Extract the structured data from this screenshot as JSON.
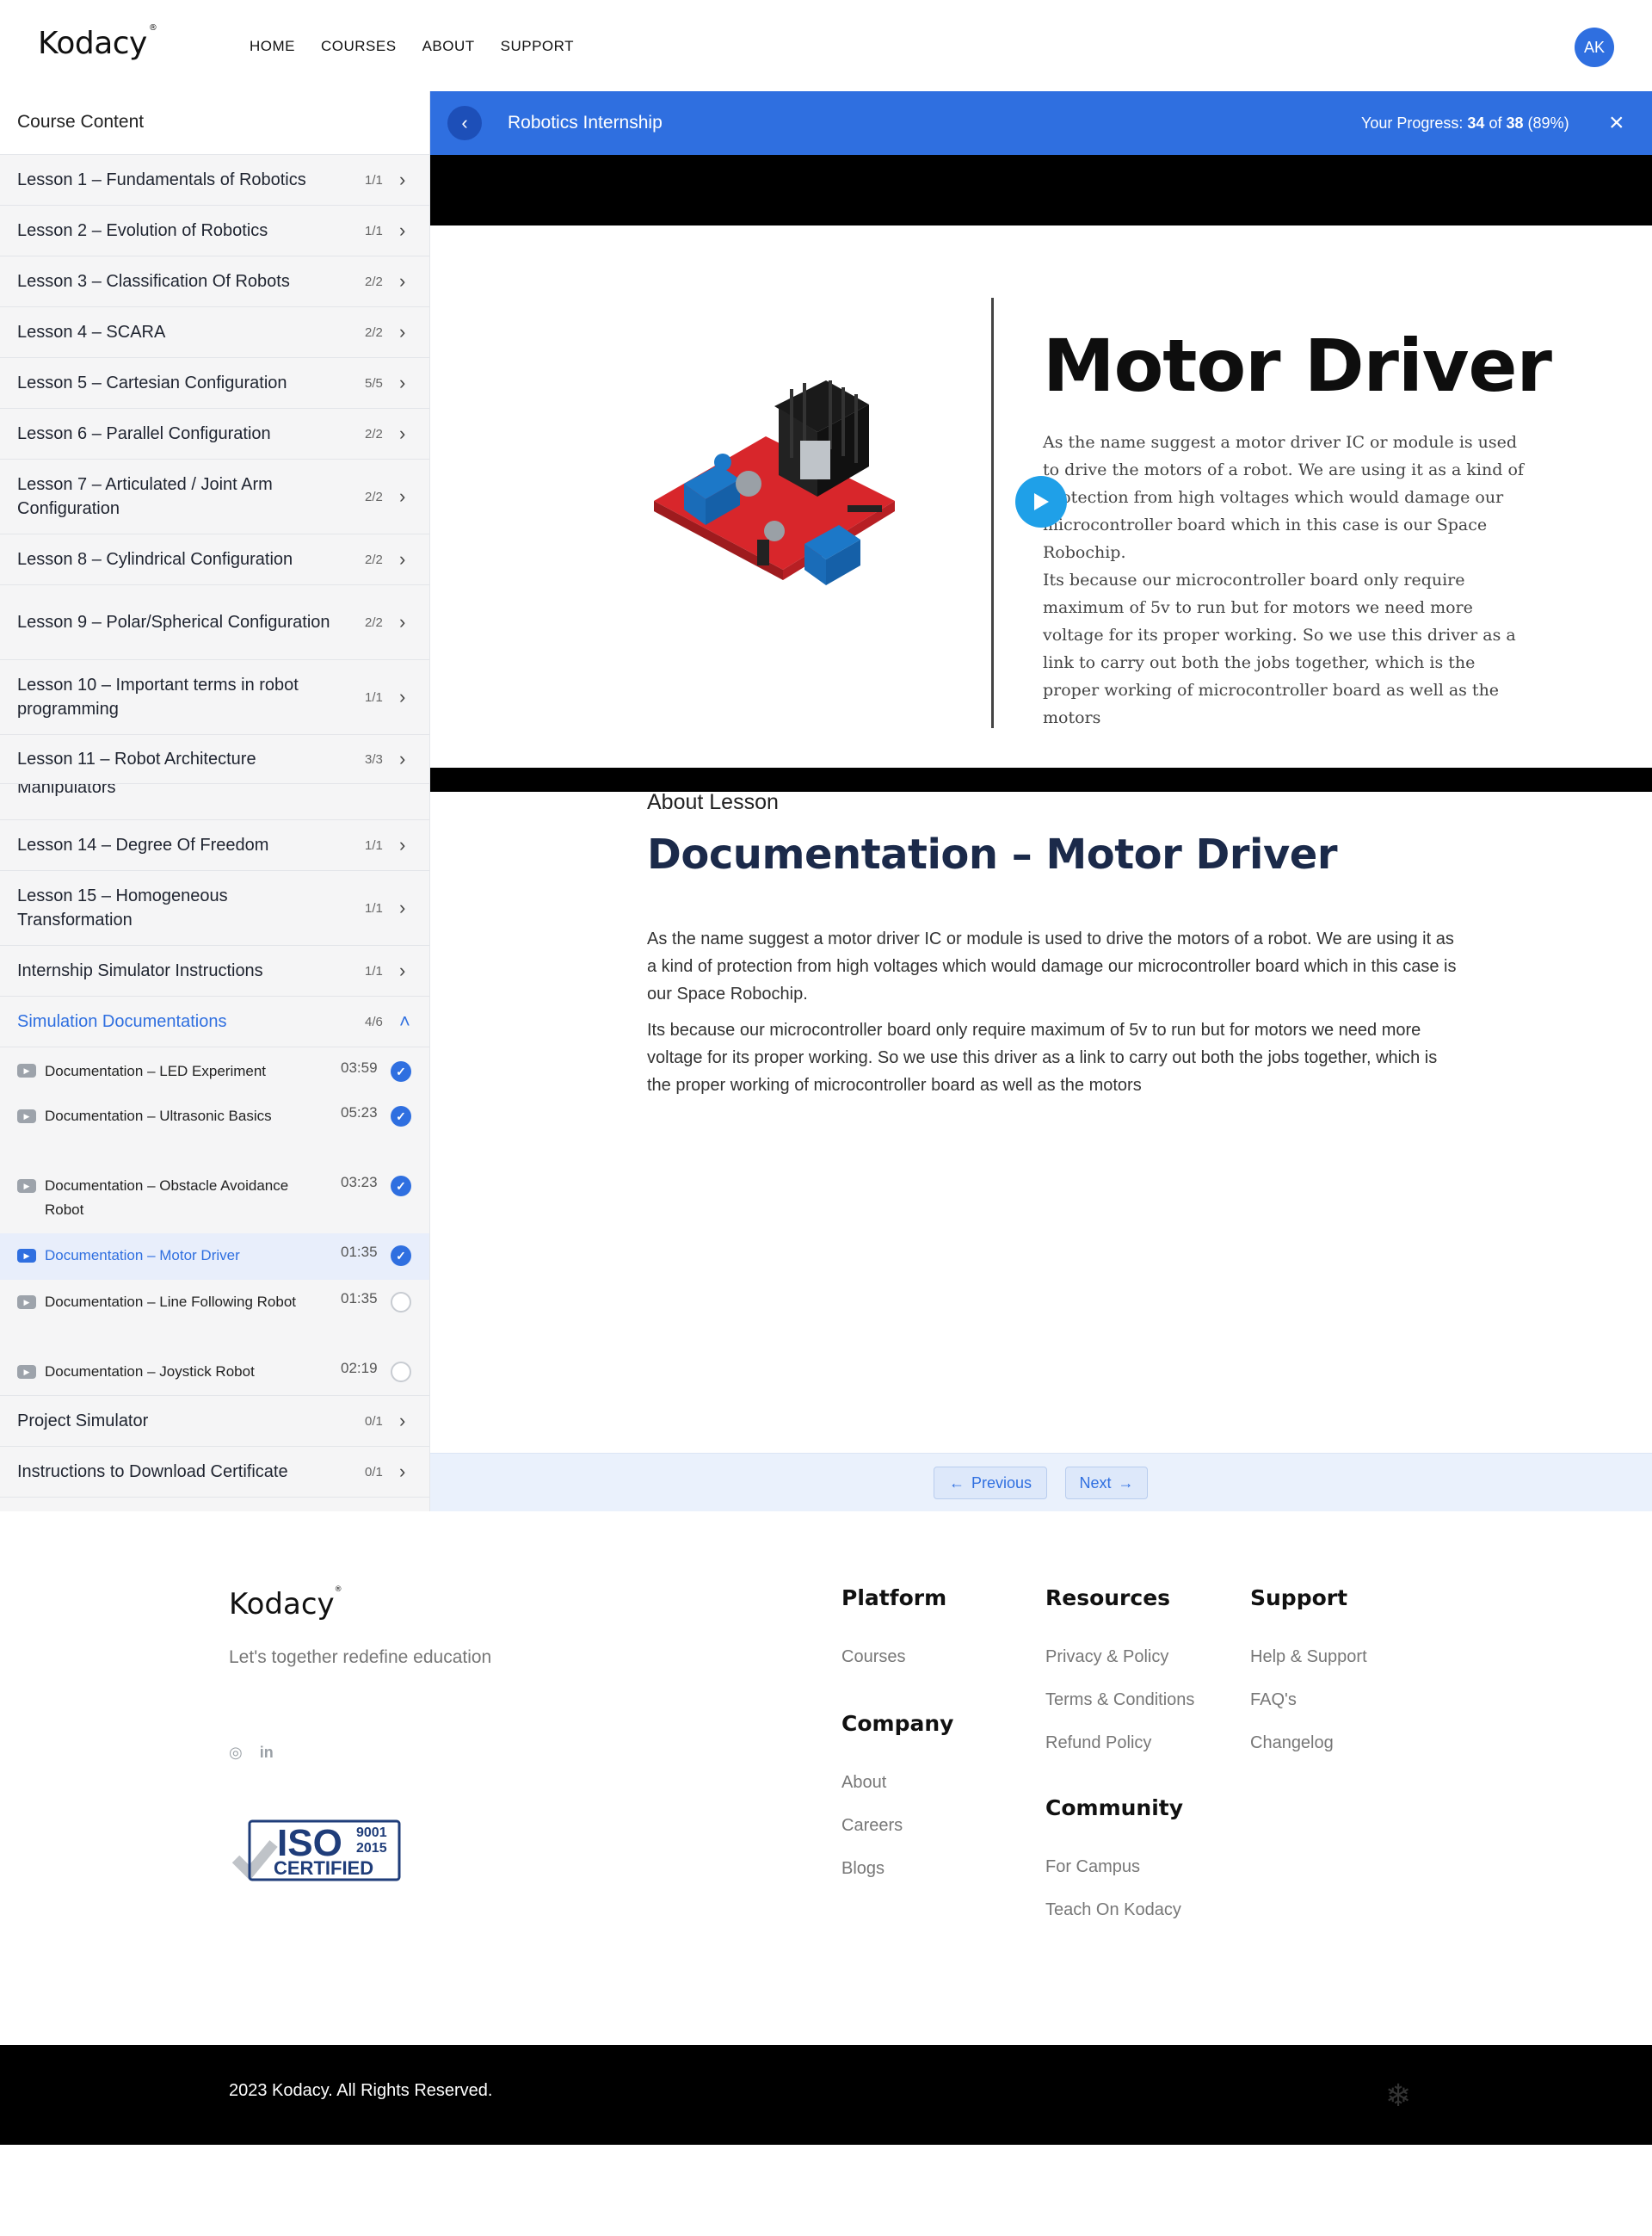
{
  "header": {
    "logo": "Kodacy",
    "nav": [
      "HOME",
      "COURSES",
      "ABOUT",
      "SUPPORT"
    ],
    "avatar": "AK"
  },
  "sidebar": {
    "title": "Course Content",
    "lessons": [
      {
        "label": "Lesson 1 – Fundamentals of Robotics",
        "count": "1/1"
      },
      {
        "label": "Lesson 2 – Evolution of Robotics",
        "count": "1/1"
      },
      {
        "label": "Lesson 3 – Classification Of Robots",
        "count": "2/2"
      },
      {
        "label": "Lesson 4 – SCARA",
        "count": "2/2"
      },
      {
        "label": "Lesson 5 – Cartesian Configuration",
        "count": "5/5"
      },
      {
        "label": "Lesson 6 – Parallel Configuration",
        "count": "2/2"
      },
      {
        "label": "Lesson 7 – Articulated / Joint Arm Configuration",
        "count": "2/2"
      },
      {
        "label": "Lesson 8 – Cylindrical Configuration",
        "count": "2/2"
      },
      {
        "label": "Lesson 9 – Polar/Spherical Configuration",
        "count": "2/2"
      },
      {
        "label": "Lesson 10 – Important terms in robot programming",
        "count": "1/1"
      },
      {
        "label": "Lesson 11 – Robot Architecture",
        "count": "3/3"
      },
      {
        "label": "Manipulators",
        "count": ""
      },
      {
        "label": "Lesson 14 – Degree Of Freedom",
        "count": "1/1"
      },
      {
        "label": "Lesson 15 – Homogeneous Transformation",
        "count": "1/1"
      },
      {
        "label": "Internship Simulator Instructions",
        "count": "1/1"
      },
      {
        "label": "Simulation Documentations",
        "count": "4/6"
      },
      {
        "label": "Project Simulator",
        "count": "0/1"
      },
      {
        "label": "Instructions to Download Certificate",
        "count": "0/1"
      }
    ],
    "sub_items": [
      {
        "label": "Documentation – LED Experiment",
        "duration": "03:59",
        "done": true
      },
      {
        "label": "Documentation – Ultrasonic Basics",
        "duration": "05:23",
        "done": true
      },
      {
        "label": "Documentation – Obstacle Avoidance Robot",
        "duration": "03:23",
        "done": true
      },
      {
        "label": "Documentation – Motor Driver",
        "duration": "01:35",
        "done": true
      },
      {
        "label": "Documentation – Line Following Robot",
        "duration": "01:35",
        "done": false
      },
      {
        "label": "Documentation – Joystick Robot",
        "duration": "02:19",
        "done": false
      }
    ]
  },
  "course_bar": {
    "title": "Robotics Internship",
    "progress_label": "Your Progress:",
    "progress_done": "34",
    "progress_of": "of",
    "progress_total": "38",
    "progress_pct": "(89%)",
    "progress_fraction": 0.89
  },
  "video": {
    "slide_title": "Motor Driver",
    "slide_p1": "As the name suggest a motor driver IC or module is used to drive the motors of a robot. We are using it as a kind of protection from high voltages which would damage our microcontroller board which in this case is our Space Robochip.",
    "slide_p2": "Its because our microcontroller board only require maximum of 5v to run but for motors we need more voltage for its proper working. So we use this driver as a link to carry out both the jobs together, which is the proper working of microcontroller board as well as the motors"
  },
  "about": {
    "label": "About Lesson",
    "heading": "Documentation – Motor Driver",
    "p1": "As the name suggest a motor driver IC or module is used to drive the motors of a robot. We are using it as a kind of protection from high voltages which would damage our microcontroller board which in this case is our Space Robochip.",
    "p2": "Its because our microcontroller board only require maximum of 5v to run but for motors we need more voltage for its proper working. So we use this driver as a link to carry out both the jobs together, which is the proper working of microcontroller board as well as the motors"
  },
  "pager": {
    "prev": "Previous",
    "next": "Next"
  },
  "footer": {
    "logo": "Kodacy",
    "tagline": "Let's together redefine education",
    "iso_top": "ISO",
    "iso_num1": "9001",
    "iso_num2": "2015",
    "iso_cert": "CERTIFIED",
    "platform_h": "Platform",
    "platform_links": [
      "Courses"
    ],
    "company_h": "Company",
    "company_links": [
      "About",
      "Careers",
      "Blogs"
    ],
    "resources_h": "Resources",
    "resources_links": [
      "Privacy & Policy",
      "Terms & Conditions",
      "Refund Policy"
    ],
    "community_h": "Community",
    "community_links": [
      "For Campus",
      "Teach On Kodacy"
    ],
    "support_h": "Support",
    "support_links": [
      "Help & Support",
      "FAQ's",
      "Changelog"
    ],
    "copyright": "2023 Kodacy. All Rights Reserved."
  }
}
